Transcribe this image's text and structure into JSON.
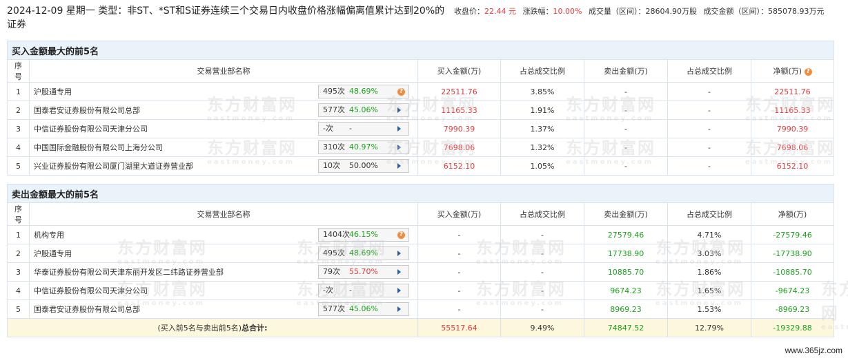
{
  "header": {
    "title": "2024-12-09 星期一 类型：非ST、*ST和S证券连续三个交易日内收盘价格涨幅偏离值累计达到20%的证券",
    "close_label": "收盘价：",
    "close_value": "22.44 元",
    "change_label": "涨跌幅：",
    "change_value": "10.00%",
    "volume_label": "成交量（区间）：",
    "volume_value": "28604.90万股",
    "amount_label": "成交金额（区间）：",
    "amount_value": "585078.93万元"
  },
  "watermark": {
    "cn": "东方财富网",
    "en": "eastmoney.com"
  },
  "columns": {
    "idx": "序号",
    "name": "交易营业部名称",
    "buy": "买入金额(万)",
    "buy_pct": "占总成交比例",
    "sell": "卖出金额(万)",
    "sell_pct": "占总成交比例",
    "net": "净额(万)"
  },
  "buy_section": {
    "title": "买入金额最大的前5名",
    "rows": [
      {
        "idx": "1",
        "name": "沪股通专用",
        "count": "495次",
        "rate": "48.69%",
        "rate_color": "green",
        "icon": "help-icon",
        "buy": "22511.76",
        "buy_pct": "3.85%",
        "sell": "-",
        "sell_pct": "-",
        "net": "22511.76"
      },
      {
        "idx": "2",
        "name": "国泰君安证券股份有限公司总部",
        "count": "577次",
        "rate": "45.06%",
        "rate_color": "green",
        "icon": "arrow-right-icon",
        "buy": "11165.33",
        "buy_pct": "1.91%",
        "sell": "-",
        "sell_pct": "-",
        "net": "11165.33"
      },
      {
        "idx": "3",
        "name": "中信证券股份有限公司天津分公司",
        "count": "-次",
        "rate": "-",
        "rate_color": "neutral",
        "icon": "arrow-right-icon",
        "buy": "7990.39",
        "buy_pct": "1.37%",
        "sell": "-",
        "sell_pct": "-",
        "net": "7990.39"
      },
      {
        "idx": "4",
        "name": "中国国际金融股份有限公司上海分公司",
        "count": "310次",
        "rate": "40.97%",
        "rate_color": "green",
        "icon": "arrow-right-icon",
        "buy": "7698.06",
        "buy_pct": "1.32%",
        "sell": "-",
        "sell_pct": "-",
        "net": "7698.06"
      },
      {
        "idx": "5",
        "name": "兴业证券股份有限公司厦门湖里大道证券营业部",
        "count": "10次",
        "rate": "50.00%",
        "rate_color": "neutral",
        "icon": "arrow-right-icon",
        "buy": "6152.10",
        "buy_pct": "1.05%",
        "sell": "-",
        "sell_pct": "-",
        "net": "6152.10"
      }
    ]
  },
  "sell_section": {
    "title": "卖出金额最大的前5名",
    "rows": [
      {
        "idx": "1",
        "name": "机构专用",
        "count": "1404次",
        "rate": "46.15%",
        "rate_color": "green",
        "icon": "help-icon",
        "buy": "-",
        "buy_pct": "-",
        "sell": "27579.46",
        "sell_pct": "4.71%",
        "net": "-27579.46"
      },
      {
        "idx": "2",
        "name": "沪股通专用",
        "count": "495次",
        "rate": "48.69%",
        "rate_color": "green",
        "icon": "arrow-right-icon",
        "buy": "-",
        "buy_pct": "-",
        "sell": "17738.90",
        "sell_pct": "3.03%",
        "net": "-17738.90"
      },
      {
        "idx": "3",
        "name": "华泰证券股份有限公司天津东丽开发区二纬路证券营业部",
        "count": "79次",
        "rate": "55.70%",
        "rate_color": "red",
        "icon": "arrow-right-icon",
        "buy": "-",
        "buy_pct": "-",
        "sell": "10885.70",
        "sell_pct": "1.86%",
        "net": "-10885.70"
      },
      {
        "idx": "4",
        "name": "中信证券股份有限公司天津分公司",
        "count": "-次",
        "rate": "-",
        "rate_color": "neutral",
        "icon": "arrow-right-icon",
        "buy": "-",
        "buy_pct": "-",
        "sell": "9674.23",
        "sell_pct": "1.65%",
        "net": "-9674.23"
      },
      {
        "idx": "5",
        "name": "国泰君安证券股份有限公司总部",
        "count": "577次",
        "rate": "45.06%",
        "rate_color": "green",
        "icon": "arrow-right-icon",
        "buy": "-",
        "buy_pct": "-",
        "sell": "8969.23",
        "sell_pct": "1.53%",
        "net": "-8969.23"
      }
    ]
  },
  "total": {
    "label": "(买入前5名与卖出前5名)",
    "label_bold": "总合计:",
    "buy": "55517.64",
    "buy_pct": "9.49%",
    "sell": "74847.52",
    "sell_pct": "12.79%",
    "net": "-19329.88"
  },
  "site_mark": "www.365jz.com"
}
